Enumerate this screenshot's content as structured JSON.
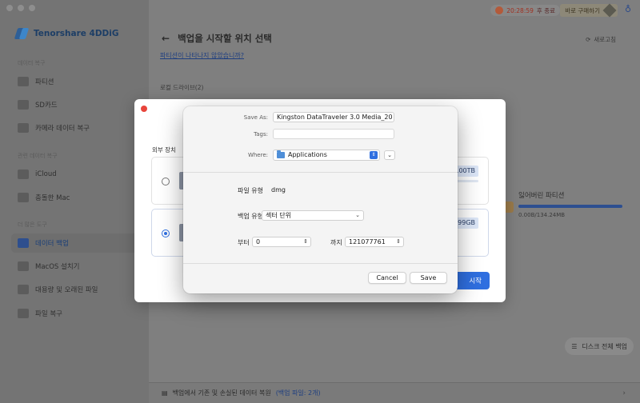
{
  "app": {
    "name": "Tenorshare 4DDiG",
    "timer_value": "20:28:59",
    "timer_text": "후 종료",
    "buy_label": "바로 구매하기"
  },
  "sidebar": {
    "sections": [
      {
        "label": "데이터 복구",
        "items": [
          {
            "label": "파티션"
          },
          {
            "label": "SD카드"
          },
          {
            "label": "카메라 데이터 복구"
          }
        ]
      },
      {
        "label": "관련 데이터 복구",
        "items": [
          {
            "label": "iCloud"
          },
          {
            "label": "충돌한 Mac"
          }
        ]
      },
      {
        "label": "더 많은 도구",
        "items": [
          {
            "label": "데이터 백업",
            "active": true
          },
          {
            "label": "MacOS 설치기"
          },
          {
            "label": "대용량 및 오래된 파일"
          },
          {
            "label": "파일 복구"
          }
        ]
      }
    ]
  },
  "main": {
    "title": "백업을 시작할 위치 선택",
    "refresh_label": "새로고침",
    "help_link": "파티션이 나타나지 않았습니까?",
    "local_drives_label": "로컬 드라이브(2)",
    "lost_partition": {
      "name": "잃어버린 파티션",
      "size": "0.00B/134.24MB"
    },
    "disk_backup_label": "디스크 전체 백업",
    "footer_text": "백업에서 기존 및 손실된 데이터 복원",
    "footer_count": "(백업 파일: 2개)"
  },
  "backup_modal": {
    "external_label": "외부 장치",
    "devices": [
      {
        "capacity": "1.00TB",
        "selected": false
      },
      {
        "capacity": "4.99GB",
        "selected": true
      }
    ],
    "start_label": "시작"
  },
  "save_sheet": {
    "save_as_label": "Save As:",
    "save_as_value": "Kingston DataTraveler 3.0 Media_20",
    "tags_label": "Tags:",
    "tags_value": "",
    "where_label": "Where:",
    "where_value": "Applications",
    "file_type_label": "파일 유형",
    "file_type_value": "dmg",
    "backup_type_label": "백업 유형",
    "backup_type_value": "섹터 단위",
    "from_label": "부터",
    "from_value": "0",
    "to_label": "까지",
    "to_value": "121077761",
    "cancel_label": "Cancel",
    "save_label": "Save"
  }
}
